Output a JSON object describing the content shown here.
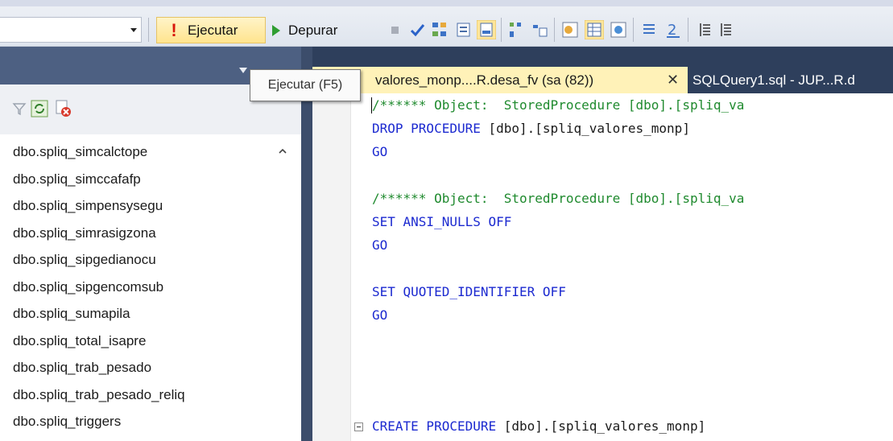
{
  "toolbar": {
    "execute_label": "Ejecutar",
    "debug_label": "Depurar",
    "execute_icon": "exclamation-icon",
    "debug_icon": "play-icon"
  },
  "tooltip": {
    "text": "Ejecutar (F5)"
  },
  "object_explorer": {
    "toolbar_icons": [
      "filter-icon",
      "refresh-icon",
      "stop-filter-icon"
    ],
    "items": [
      "dbo.spliq_simcalctope",
      "dbo.spliq_simccafafp",
      "dbo.spliq_simpensysegu",
      "dbo.spliq_simrasigzona",
      "dbo.spliq_sipgedianocu",
      "dbo.spliq_sipgencomsub",
      "dbo.spliq_sumapila",
      "dbo.spliq_total_isapre",
      "dbo.spliq_trab_pesado",
      "dbo.spliq_trab_pesado_reliq",
      "dbo.spliq_triggers"
    ]
  },
  "tabs": {
    "active": "valores_monp....R.desa_fv (sa (82))",
    "other": "SQLQuery1.sql - JUP...R.d"
  },
  "code": {
    "line1": "/****** Object:  StoredProcedure [dbo].[spliq_va",
    "line2_kw": "DROP PROCEDURE",
    "line2_txt": " [dbo].[spliq_valores_monp]",
    "go": "GO",
    "line4": "/****** Object:  StoredProcedure [dbo].[spliq_va",
    "line5_kw": "SET ANSI_NULLS OFF",
    "line7_kw": "SET QUOTED_IDENTIFIER OFF",
    "line9_kw": "CREATE PROCEDURE",
    "line9_txt": " [dbo].[spliq_valores_monp]"
  },
  "colors": {
    "comment": "#1f8a2e",
    "keyword": "#1c2ad0",
    "active_tab": "#fff2b8",
    "frame": "#293955"
  }
}
